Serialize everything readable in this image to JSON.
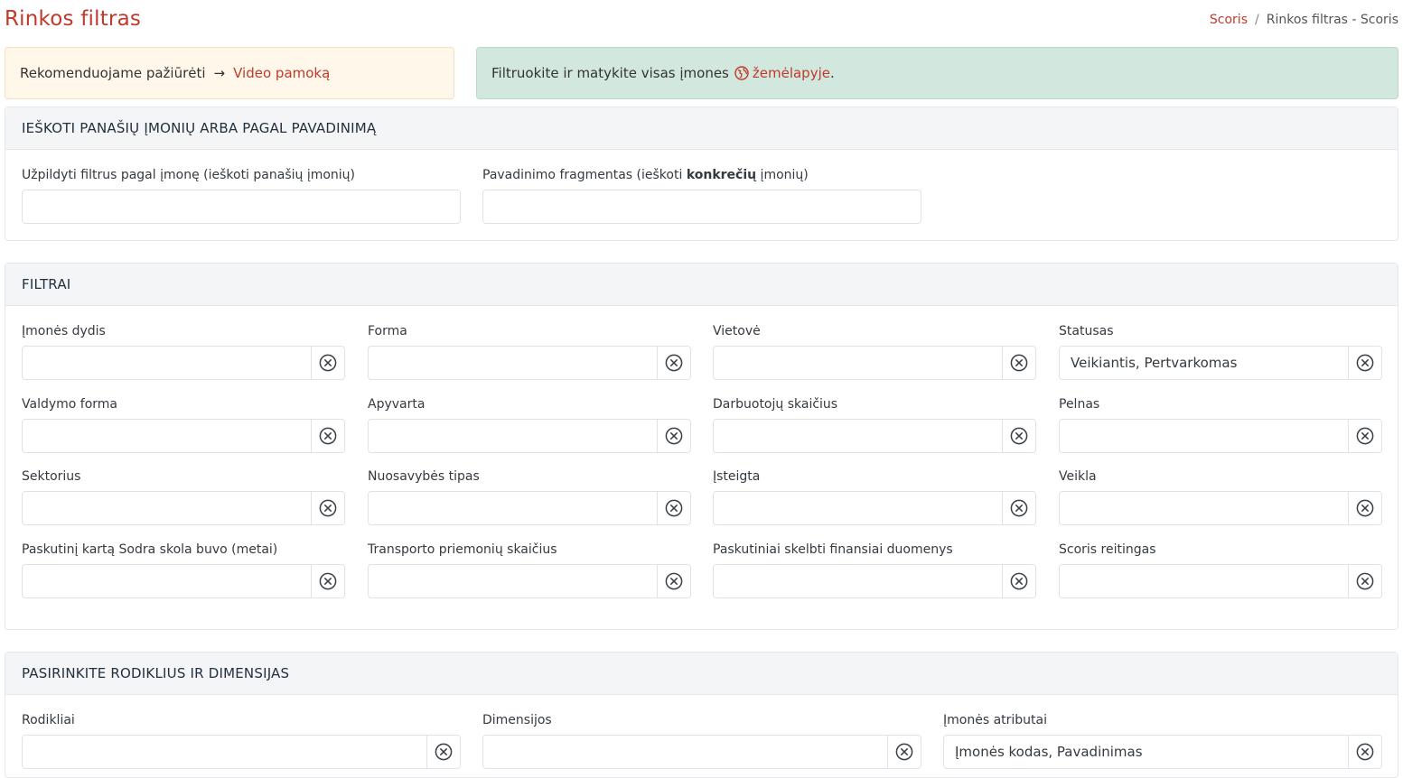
{
  "header": {
    "title": "Rinkos filtras",
    "breadcrumb": {
      "home": "Scoris",
      "separator": "/",
      "current": "Rinkos filtras - Scoris"
    }
  },
  "alerts": {
    "recommend_text": "Rekomenduojame pažiūrėti",
    "recommend_arrow": "→",
    "video_link": "Video pamoką",
    "map_text": "Filtruokite ir matykite visas įmones",
    "map_link": "žemėlapyje",
    "map_suffix": "."
  },
  "search_section": {
    "title": "Ieškoti panašių įmonių arba pagal pavadinimą",
    "similar_label": "Užpildyti filtrus pagal įmonę (ieškoti panašių įmonių)",
    "similar_value": "",
    "name_label_prefix": "Pavadinimo fragmentas (ieškoti ",
    "name_label_bold": "konkrečių",
    "name_label_suffix": " įmonių)",
    "name_value": ""
  },
  "filters_section": {
    "title": "Filtrai",
    "fields": [
      {
        "label": "Įmonės dydis",
        "value": ""
      },
      {
        "label": "Forma",
        "value": ""
      },
      {
        "label": "Vietovė",
        "value": ""
      },
      {
        "label": "Statusas",
        "value": "Veikiantis, Pertvarkomas"
      },
      {
        "label": "Valdymo forma",
        "value": ""
      },
      {
        "label": "Apyvarta",
        "value": ""
      },
      {
        "label": "Darbuotojų skaičius",
        "value": ""
      },
      {
        "label": "Pelnas",
        "value": ""
      },
      {
        "label": "Sektorius",
        "value": ""
      },
      {
        "label": "Nuosavybės tipas",
        "value": ""
      },
      {
        "label": "Įsteigta",
        "value": ""
      },
      {
        "label": "Veikla",
        "value": ""
      },
      {
        "label": "Paskutinį kartą Sodra skola buvo (metai)",
        "value": ""
      },
      {
        "label": "Transporto priemonių skaičius",
        "value": ""
      },
      {
        "label": "Paskutiniai skelbti finansiai duomenys",
        "value": ""
      },
      {
        "label": "Scoris reitingas",
        "value": ""
      }
    ]
  },
  "metrics_section": {
    "title": "Pasirinkite rodiklius ir dimensijas",
    "fields": [
      {
        "label": "Rodikliai",
        "value": ""
      },
      {
        "label": "Dimensijos",
        "value": ""
      },
      {
        "label": "Įmonės atributai",
        "value": "Įmonės kodas, Pavadinimas"
      }
    ]
  },
  "icons": {
    "clear": "circle-x-icon",
    "globe": "globe-icon"
  },
  "colors": {
    "accent": "#c0392b",
    "success_bg": "#d2e8de",
    "warning_bg": "#fff8ea"
  }
}
